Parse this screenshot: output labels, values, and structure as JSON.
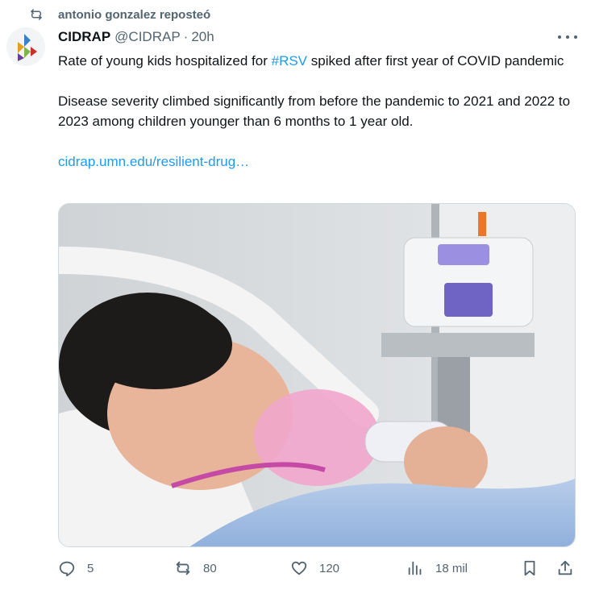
{
  "repost": {
    "icon": "repost-icon",
    "text": "antonio gonzalez reposteó"
  },
  "tweet": {
    "author_name": "CIDRAP",
    "author_handle": "@CIDRAP",
    "separator": "·",
    "time": "20h",
    "text_before_hashtag": "Rate of young kids hospitalized for ",
    "hashtag": "#RSV",
    "text_after_hashtag": " spiked after first year of COVID pandemic",
    "paragraph2": "Disease severity climbed significantly from before the pandemic to 2021 and 2022 to 2023 among children younger than 6 months to 1 year old.",
    "link": "cidrap.umn.edu/resilient-drug…"
  },
  "actions": {
    "reply_count": "5",
    "repost_count": "80",
    "like_count": "120",
    "views_count": "18 mil"
  },
  "colors": {
    "accent": "#1d9bf0",
    "muted": "#536471",
    "text": "#0f1419"
  }
}
